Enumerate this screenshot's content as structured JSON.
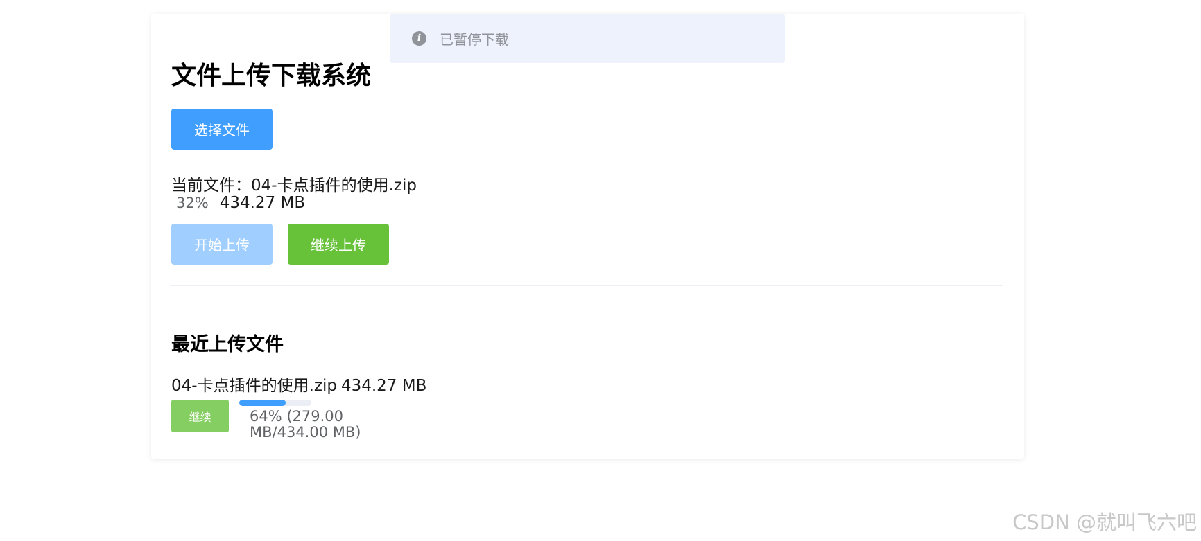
{
  "toast": {
    "message": "已暂停下载"
  },
  "uploader": {
    "title": "文件上传下载系统",
    "select_button": "选择文件",
    "current_file_text": "当前文件：04-卡点插件的使用.zip",
    "current_progress_text": "32%",
    "current_progress": 0.32,
    "current_size": "434.27 MB",
    "start_button": "开始上传",
    "resume_button": "继续上传"
  },
  "recent": {
    "title": "最近上传文件",
    "items": [
      {
        "name": "04-卡点插件的使用.zip",
        "size": "434.27 MB",
        "action_label": "继续",
        "progress": 0.64,
        "progress_text": "64% (279.00 MB/434.00 MB)"
      }
    ]
  },
  "watermark": "CSDN @就叫飞六吧",
  "colors": {
    "primary": "#409eff",
    "success": "#67c23a",
    "info": "#909399"
  }
}
